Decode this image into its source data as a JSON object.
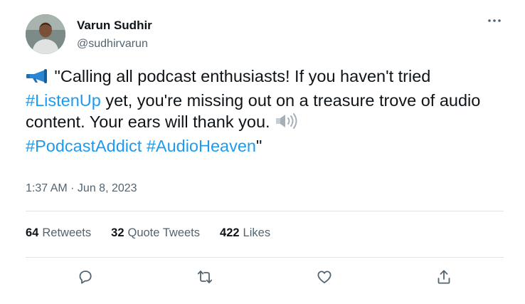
{
  "user": {
    "display_name": "Varun Sudhir",
    "handle": "@sudhirvarun"
  },
  "tweet": {
    "segments": [
      {
        "kind": "text",
        "value": "\"Calling all podcast enthusiasts! If you haven't tried "
      },
      {
        "kind": "tag",
        "value": "#ListenUp"
      },
      {
        "kind": "text",
        "value": " yet, you're missing out on a treasure trove of audio content. Your ears will thank you. "
      },
      {
        "kind": "tag",
        "value": "#PodcastAddict"
      },
      {
        "kind": "text",
        "value": " "
      },
      {
        "kind": "tag",
        "value": "#AudioHeaven"
      },
      {
        "kind": "text",
        "value": "\""
      }
    ],
    "leading_emoji": "megaphone-icon",
    "inline_emoji": "speaker-high-volume-icon",
    "timestamp": "1:37 AM · Jun 8, 2023"
  },
  "stats": {
    "retweets": {
      "count": "64",
      "label": "Retweets"
    },
    "quotes": {
      "count": "32",
      "label": "Quote Tweets"
    },
    "likes": {
      "count": "422",
      "label": "Likes"
    }
  },
  "actions": [
    "reply-icon",
    "retweet-icon",
    "like-icon",
    "share-icon"
  ],
  "colors": {
    "accent": "#1d9bf0",
    "text": "#0f1419",
    "muted": "#536471",
    "divider": "#e1e5e8"
  }
}
